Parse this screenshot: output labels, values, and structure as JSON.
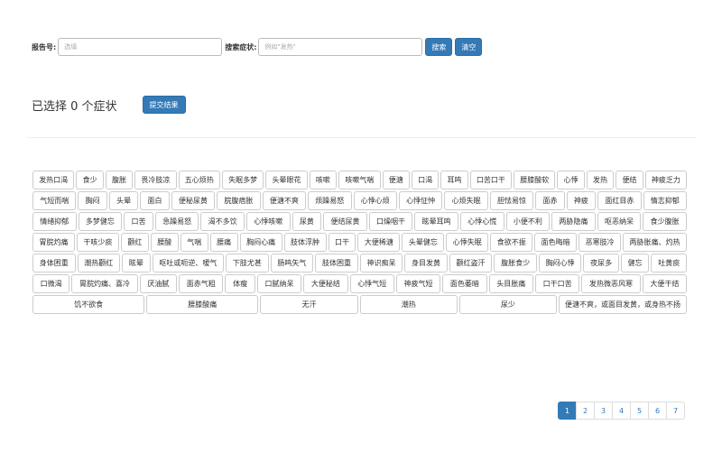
{
  "search": {
    "report_label": "报告号:",
    "report_placeholder": "选填",
    "symptom_label": "搜索症状:",
    "symptom_placeholder": "例如\"发热\"",
    "search_button": "搜索",
    "clear_button": "清空"
  },
  "summary": {
    "selected_text": "已选择 0 个症状",
    "submit_button": "提交结果"
  },
  "symptoms": [
    "发热口渴",
    "食少",
    "腹胀",
    "畏冷肢凉",
    "五心烦热",
    "失眠多梦",
    "头晕眼花",
    "咳嗽",
    "咳嗽气喘",
    "便溏",
    "口渴",
    "耳鸣",
    "口苦口干",
    "腰膝酸软",
    "心悸",
    "发热",
    "便结",
    "神疲乏力",
    "气短而喘",
    "胸闷",
    "头晕",
    "面白",
    "便秘尿黄",
    "脘腹痞胀",
    "便溏不爽",
    "烦躁易怒",
    "心悸心烦",
    "心悸怔忡",
    "心烦失眠",
    "胆怯易惊",
    "面赤",
    "神疲",
    "面红目赤",
    "情志抑郁",
    "情绪抑郁",
    "多梦健忘",
    "口苦",
    "急躁易怒",
    "渴不多饮",
    "心悸咳嗽",
    "尿黄",
    "便结尿黄",
    "口燥咽干",
    "眩晕耳鸣",
    "心悸心慌",
    "小便不利",
    "两胁隐痛",
    "呕恶纳呆",
    "食少腹胀",
    "胃脘灼痛",
    "干咳少痰",
    "颧红",
    "腰酸",
    "气喘",
    "腰痛",
    "胸闷心痛",
    "肢体浮肿",
    "口干",
    "大便稀溏",
    "头晕健忘",
    "心悸失眠",
    "食欲不振",
    "面色晦暗",
    "恶寒肢冷",
    "两胁胀痛、灼热",
    "身体困重",
    "潮热颧红",
    "眩晕",
    "呕吐或呃逆、嗳气",
    "下肢尤甚",
    "肠鸣矢气",
    "肢体困重",
    "神识痴呆",
    "身目发黄",
    "颧红盗汗",
    "腹胀食少",
    "胸闷心悸",
    "夜尿多",
    "健忘",
    "吐黄痰",
    "口微渴",
    "胃脘灼痛、喜冷",
    "厌油腻",
    "面赤气粗",
    "体瘦",
    "口腻纳呆",
    "大便秘结",
    "心悸气短",
    "神疲气短",
    "面色萎暗",
    "头目胀痛",
    "口干口苦",
    "发热微恶风寒",
    "大便干结",
    "饥不欲食",
    "腰膝酸痛",
    "无汗",
    "潮热",
    "尿少",
    "便溏不爽，或面目发黄，或身热不扬"
  ],
  "pagination": [
    "1",
    "2",
    "3",
    "4",
    "5",
    "6",
    "7"
  ],
  "colors": {
    "primary": "#337ab7",
    "border": "#cccccc"
  }
}
